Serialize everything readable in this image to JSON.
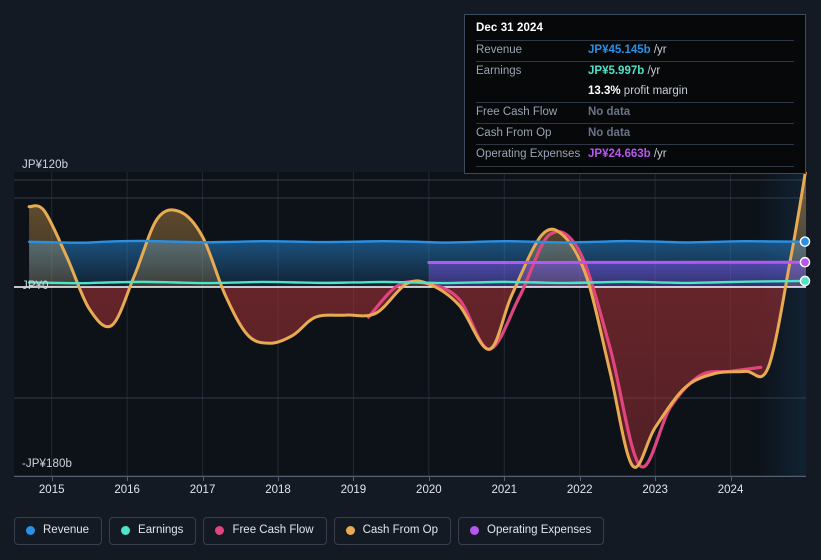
{
  "chart_data": {
    "type": "area",
    "title": "",
    "xlabel": "",
    "ylabel": "",
    "currency": "JP¥",
    "ylim": [
      -180,
      120
    ],
    "y_ticks": [
      {
        "value": 120,
        "label": "JP¥120b"
      },
      {
        "value": 0,
        "label": "JP¥0"
      },
      {
        "value": -180,
        "label": "-JP¥180b"
      }
    ],
    "x_ticks": [
      "2015",
      "2016",
      "2017",
      "2018",
      "2019",
      "2020",
      "2021",
      "2022",
      "2023",
      "2024"
    ],
    "x_range": [
      "2014.5",
      "2025.0"
    ],
    "grid": true,
    "legend_position": "bottom",
    "series": [
      {
        "name": "Revenue",
        "color": "#2a90e3",
        "x": [
          2014.7,
          2015.0,
          2015.4,
          2015.8,
          2016.2,
          2016.6,
          2017.0,
          2017.4,
          2017.8,
          2018.2,
          2018.6,
          2019.0,
          2019.4,
          2019.8,
          2020.2,
          2020.6,
          2021.0,
          2021.4,
          2021.8,
          2022.2,
          2022.6,
          2023.0,
          2023.4,
          2023.8,
          2024.2,
          2024.6,
          2025.0
        ],
        "values": [
          45.0,
          44.6,
          44.1,
          45.4,
          45.9,
          45.2,
          44.5,
          45.0,
          45.6,
          45.2,
          44.7,
          45.1,
          45.6,
          45.1,
          44.3,
          44.9,
          45.6,
          45.1,
          44.4,
          45.0,
          45.7,
          45.2,
          44.4,
          45.0,
          45.6,
          45.3,
          45.145
        ],
        "end_value": 45.145,
        "end_label": "JP¥45.145b"
      },
      {
        "name": "Earnings",
        "color": "#4fe3c8",
        "x": [
          2014.7,
          2015.0,
          2015.4,
          2015.8,
          2016.2,
          2016.6,
          2017.0,
          2017.4,
          2017.8,
          2018.2,
          2018.6,
          2019.0,
          2019.4,
          2019.8,
          2020.2,
          2020.6,
          2021.0,
          2021.4,
          2021.8,
          2022.2,
          2022.6,
          2023.0,
          2023.4,
          2023.8,
          2024.2,
          2024.6,
          2025.0
        ],
        "values": [
          4.5,
          4.2,
          3.8,
          4.6,
          5.1,
          4.6,
          3.9,
          4.4,
          5.0,
          4.6,
          4.1,
          4.5,
          5.0,
          4.6,
          3.9,
          4.5,
          5.1,
          4.6,
          4.0,
          4.6,
          5.2,
          4.7,
          4.0,
          4.6,
          5.3,
          5.7,
          5.997
        ],
        "end_value": 5.997,
        "end_label": "JP¥5.997b"
      },
      {
        "name": "Free Cash Flow",
        "color": "#e0457f",
        "x": [
          2019.2,
          2019.6,
          2020.0,
          2020.4,
          2020.8,
          2021.2,
          2021.6,
          2022.0,
          2022.4,
          2022.8,
          2023.2,
          2023.6,
          2024.0,
          2024.4
        ],
        "values": [
          -30.0,
          2.0,
          3.0,
          -12.0,
          -62.0,
          -10.0,
          52.0,
          35.0,
          -60.0,
          -178.0,
          -120.0,
          -88.0,
          -84.0,
          -80.0
        ],
        "end_value": null,
        "end_label": "No data"
      },
      {
        "name": "Cash From Op",
        "color": "#e8ab52",
        "x": [
          2014.7,
          2014.9,
          2015.2,
          2015.5,
          2015.8,
          2016.1,
          2016.4,
          2016.7,
          2017.0,
          2017.3,
          2017.6,
          2017.9,
          2018.2,
          2018.5,
          2018.9,
          2019.3,
          2019.7,
          2020.0,
          2020.4,
          2020.8,
          2021.1,
          2021.5,
          2021.8,
          2022.1,
          2022.4,
          2022.7,
          2023.0,
          2023.4,
          2023.8,
          2024.2,
          2024.5,
          2024.8,
          2025.0
        ],
        "values": [
          80.0,
          76.0,
          30.0,
          -22.0,
          -38.0,
          12.0,
          68.0,
          75.0,
          50.0,
          -8.0,
          -48.0,
          -56.0,
          -48.0,
          -30.0,
          -28.0,
          -26.0,
          3.0,
          3.0,
          -18.0,
          -62.0,
          -8.0,
          52.0,
          50.0,
          8.0,
          -84.0,
          -178.0,
          -140.0,
          -100.0,
          -86.0,
          -84.0,
          -80.0,
          30.0,
          118.0
        ],
        "end_value": null,
        "end_label": "No data"
      },
      {
        "name": "Operating Expenses",
        "color": "#b657f0",
        "x": [
          2020.0,
          2021.0,
          2022.0,
          2023.0,
          2024.0,
          2025.0
        ],
        "values": [
          24.4,
          24.4,
          24.5,
          24.5,
          24.6,
          24.663
        ],
        "end_value": 24.663,
        "end_label": "JP¥24.663b"
      }
    ]
  },
  "tooltip": {
    "date": "Dec 31 2024",
    "rows": [
      {
        "key": "Revenue",
        "amount": "JP¥45.145b",
        "unit": "/yr",
        "color": "#2a90e3",
        "muted": false
      },
      {
        "key": "Earnings",
        "amount": "JP¥5.997b",
        "unit": "/yr",
        "color": "#4fe3c8",
        "muted": false
      },
      {
        "key": "",
        "amount": "13.3%",
        "unit": "profit margin",
        "color": "#ffffff",
        "muted": false,
        "is_margin": true
      },
      {
        "key": "Free Cash Flow",
        "amount": "No data",
        "unit": "",
        "color": "#697486",
        "muted": true
      },
      {
        "key": "Cash From Op",
        "amount": "No data",
        "unit": "",
        "color": "#697486",
        "muted": true
      },
      {
        "key": "Operating Expenses",
        "amount": "JP¥24.663b",
        "unit": "/yr",
        "color": "#b657f0",
        "muted": false
      }
    ]
  },
  "legend": {
    "items": [
      {
        "label": "Revenue",
        "color": "#2a90e3"
      },
      {
        "label": "Earnings",
        "color": "#4fe3c8"
      },
      {
        "label": "Free Cash Flow",
        "color": "#e0457f"
      },
      {
        "label": "Cash From Op",
        "color": "#e8ab52"
      },
      {
        "label": "Operating Expenses",
        "color": "#b657f0"
      }
    ]
  },
  "axis": {
    "y_top_label": "JP¥120b",
    "y_zero_label": "JP¥0",
    "y_bottom_label": "-JP¥180b"
  },
  "highlight": {
    "start_year": 2024.35,
    "end_year": 2025.0
  },
  "colors": {
    "background": "#141a24",
    "plot_background": "#0d1219",
    "grid": "#323c4a",
    "zero_line": "#ffffff",
    "axis": "#55606e",
    "text": "#dfe5ec",
    "muted_text": "#9aa4b2",
    "tooltip_bg": "#07080a",
    "tooltip_border": "#3c4a5e"
  }
}
